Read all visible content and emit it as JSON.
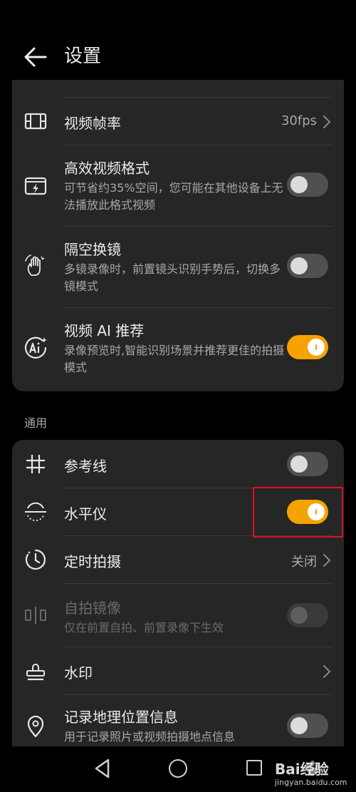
{
  "header": {
    "title": "设置"
  },
  "card_video": {
    "rows": [
      {
        "icon": "film-frame-icon",
        "title": "视频帧率",
        "value": "30fps"
      },
      {
        "icon": "efficient-format-icon",
        "title": "高效视频格式",
        "desc": "可节省约35%空间，您可能在其他设备上无法播放此格式视频",
        "toggle": "off"
      },
      {
        "icon": "hand-gesture-icon",
        "title": "隔空换镜",
        "desc": "多镜录像时，前置镜头识别手势后，切换多镜模式",
        "toggle": "off"
      },
      {
        "icon": "ai-icon",
        "title": "视频 AI 推荐",
        "desc": "录像预览时,智能识别场景并推荐更佳的拍摄模式",
        "toggle": "on"
      }
    ]
  },
  "section_general": {
    "label": "通用"
  },
  "card_general": {
    "rows": [
      {
        "icon": "grid-icon",
        "title": "参考线",
        "toggle": "off"
      },
      {
        "icon": "level-icon",
        "title": "水平仪",
        "toggle": "on"
      },
      {
        "icon": "timer-icon",
        "title": "定时拍摄",
        "value": "关闭"
      },
      {
        "icon": "mirror-icon",
        "title": "自拍镜像",
        "desc": "仅在前置自拍、前置录像下生效",
        "toggle": "disabled"
      },
      {
        "icon": "stamp-icon",
        "title": "水印"
      },
      {
        "icon": "location-pin-icon",
        "title": "记录地理位置信息",
        "desc": "用于记录照片或视频拍摄地点信息",
        "toggle": "off"
      }
    ]
  },
  "watermark": {
    "text": "Bai经验",
    "sub": "jingyan.baidu.com"
  }
}
